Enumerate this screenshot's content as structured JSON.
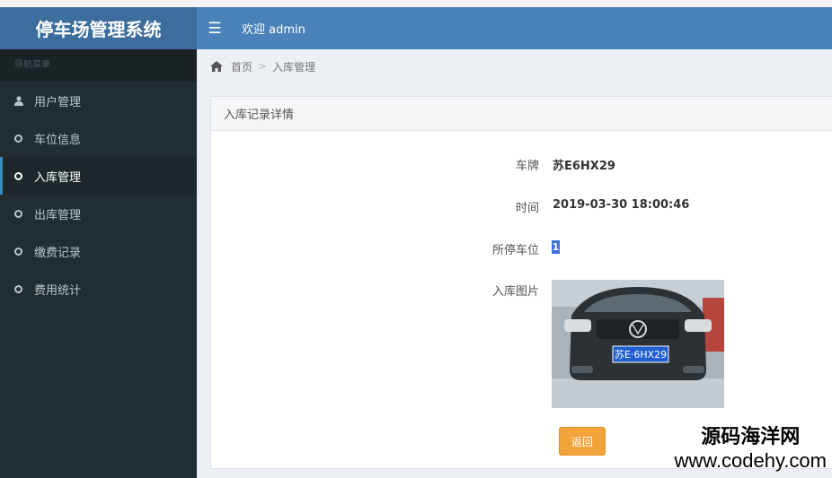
{
  "app": {
    "title": "停车场管理系统"
  },
  "header": {
    "menu_icon": "hamburger-icon",
    "welcome": "欢迎 admin"
  },
  "sidebar": {
    "caption": "导航菜单",
    "items": [
      {
        "label": "用户管理",
        "icon": "user-icon"
      },
      {
        "label": "车位信息",
        "icon": "circle-icon"
      },
      {
        "label": "入库管理",
        "icon": "circle-icon",
        "active": true
      },
      {
        "label": "出库管理",
        "icon": "circle-icon"
      },
      {
        "label": "缴费记录",
        "icon": "circle-icon"
      },
      {
        "label": "费用统计",
        "icon": "circle-icon"
      }
    ]
  },
  "breadcrumb": {
    "home": "首页",
    "sep": ">",
    "current": "入库管理"
  },
  "panel": {
    "title": "入库记录详情"
  },
  "details": {
    "plate_label": "车牌",
    "plate_value": "苏E6HX29",
    "time_label": "时间",
    "time_value": "2019-03-30 18:00:46",
    "slot_label": "所停车位",
    "slot_value": "1",
    "photo_label": "入库图片",
    "photo_plate_text": "苏E·6HX29"
  },
  "actions": {
    "back": "返回"
  },
  "watermark": {
    "line1": "源码海洋网",
    "line2": "www.codehy.com"
  },
  "colors": {
    "header": "#4a83b9",
    "brand": "#3c6d9c",
    "sidebar": "#222d32",
    "button": "#f0a43a"
  }
}
